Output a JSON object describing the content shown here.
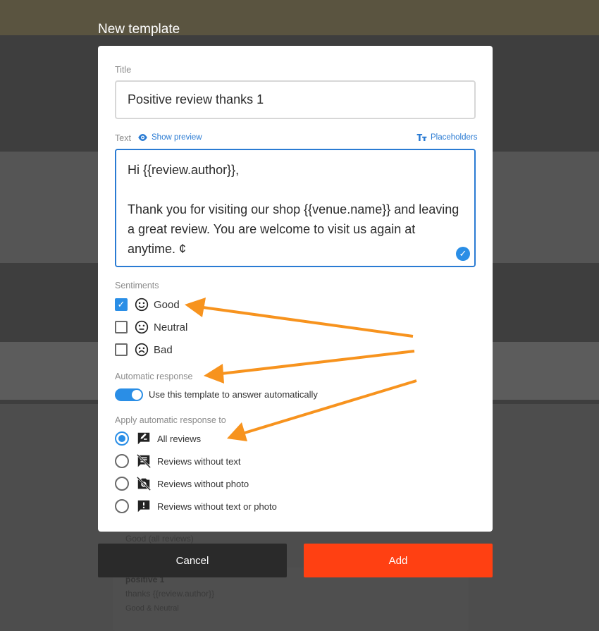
{
  "dialog": {
    "title": "New template",
    "title_field": {
      "label": "Title",
      "value": "Positive review thanks 1"
    },
    "text_field": {
      "label": "Text",
      "show_preview": "Show preview",
      "placeholders": "Placeholders",
      "value": "Hi {{review.author}},\n\nThank you for visiting our shop {{venue.name}} and leaving a great review. You are welcome to visit us again at anytime. ¢"
    },
    "sentiments": {
      "label": "Sentiments",
      "items": [
        {
          "label": "Good",
          "checked": true,
          "icon": "smile-icon"
        },
        {
          "label": "Neutral",
          "checked": false,
          "icon": "neutral-face-icon"
        },
        {
          "label": "Bad",
          "checked": false,
          "icon": "frown-icon"
        }
      ]
    },
    "automatic_response": {
      "label": "Automatic response",
      "toggle_label": "Use this template to answer automatically",
      "enabled": true
    },
    "apply_to": {
      "label": "Apply automatic response to",
      "options": [
        {
          "label": "All reviews",
          "selected": true,
          "icon": "rate-review-icon"
        },
        {
          "label": "Reviews without text",
          "selected": false,
          "icon": "no-text-review-icon"
        },
        {
          "label": "Reviews without photo",
          "selected": false,
          "icon": "no-photo-icon"
        },
        {
          "label": "Reviews without text or photo",
          "selected": false,
          "icon": "alert-review-icon"
        }
      ]
    },
    "buttons": {
      "cancel": "Cancel",
      "add": "Add"
    }
  },
  "background": {
    "bottom_card": {
      "title": "positive 1",
      "text": "thanks {{review.author}}",
      "tags": "Good & Neutral"
    },
    "filter_label": "Good (all reviews)"
  },
  "colors": {
    "accent": "#2a8ee6",
    "primary_button": "#ff4012",
    "annotation_arrow": "#f7931e"
  }
}
